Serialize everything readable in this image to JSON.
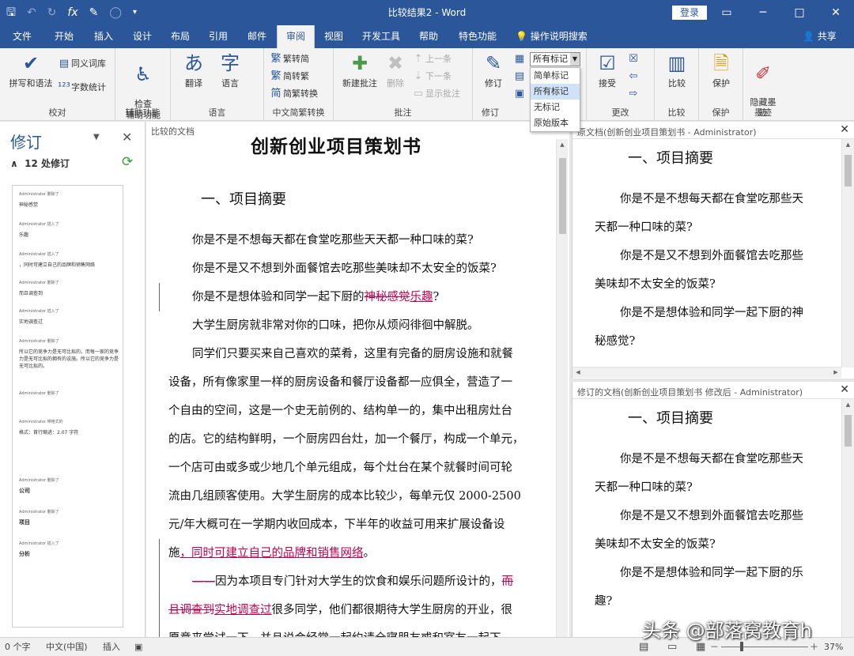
{
  "window": {
    "title": "比较结果2 - Word",
    "login": "登录",
    "controls": [
      "▭",
      "─",
      "□",
      "✕"
    ]
  },
  "qat": {
    "save": "🖫",
    "undo": "↶",
    "redo": "↻",
    "fx": "fx",
    "brush": "✎",
    "circle": "◯",
    "more": "▾"
  },
  "tabs": [
    {
      "label": "文件"
    },
    {
      "label": "开始"
    },
    {
      "label": "插入"
    },
    {
      "label": "设计"
    },
    {
      "label": "布局"
    },
    {
      "label": "引用"
    },
    {
      "label": "邮件"
    },
    {
      "label": "审阅"
    },
    {
      "label": "视图"
    },
    {
      "label": "开发工具"
    },
    {
      "label": "帮助"
    },
    {
      "label": "特色功能"
    }
  ],
  "tellme": "💡 操作说明搜索",
  "share": "👤 共享",
  "ribbon": {
    "groups": [
      "校对",
      "辅助功能",
      "语言",
      "中文简繁转换",
      "批注",
      "修订",
      "更改",
      "比较",
      "保护",
      "墨迹"
    ],
    "spelling": "拼写和语法",
    "thesaurus": "同义词库",
    "wordcount": "字数统计",
    "accessibility": "检查\n辅助功能",
    "translate": "翻译",
    "language": "语言",
    "trad": "繁转简",
    "simp": "简转繁",
    "convert": "简繁转换",
    "new_comment": "新建批注",
    "delete": "删除",
    "prev": "上一条",
    "next": "下一条",
    "show_comments": "显示批注",
    "track": "修订",
    "accept": "接受",
    "compare": "比较",
    "protect": "保护",
    "ink": "隐藏墨\n迹",
    "markup_selected": "所有标记",
    "markup_options": [
      "简单标记",
      "所有标记",
      "无标记",
      "原始版本"
    ]
  },
  "revisions": {
    "title": "修订",
    "count": "12 处修订",
    "items": [
      {
        "author": "Administrator 删除了",
        "text": "神秘感觉"
      },
      {
        "author": "Administrator 插入了",
        "text": "乐趣"
      },
      {
        "author": "Administrator 插入了",
        "text": "，同时可建立自己的品牌和销售网络"
      },
      {
        "author": "Administrator 删除了",
        "text": "而且调查到"
      },
      {
        "author": "Administrator 插入了",
        "text": "实地调查过"
      },
      {
        "author": "Administrator 删除了",
        "text": "所以它的竞争力是无可比拟的，而每一家的竞争力是无可比拟的拥有的设施。所以它的竞争力是无可比拟的。"
      },
      {
        "author": "Administrator 删除了",
        "text": ""
      },
      {
        "author": "Administrator 带格式的",
        "text": "格式：首行缩进：2.07 字符"
      },
      {
        "author": "Administrator 删除了",
        "text": "公司"
      },
      {
        "author": "Administrator 删除了",
        "text": "项目"
      },
      {
        "author": "Administrator 插入了",
        "text": "分析"
      }
    ]
  },
  "doc": {
    "label": "比较的文档",
    "title": "创新创业项目策划书",
    "heading": "一、项目摘要",
    "l1": "你是不是不想每天都在食堂吃那些天天都一种口味的菜?",
    "l2": "你是不是又不想到外面餐馆去吃那些美味却不太安全的饭菜?",
    "l3a": "你是不是想体验和同学一起下厨的",
    "l3del": "神秘感觉",
    "l3ins": "乐趣",
    "l3b": "?",
    "l4": "大学生厨房就非常对你的口味，把你从烦闷徘徊中解脱。",
    "l5": "同学们只要买来自己喜欢的菜肴，这里有完备的厨房设施和就餐",
    "l6": "设备，所有像家里一样的厨房设备和餐厅设备都一应俱全，营造了一",
    "l7": "个自由的空间，这是一个史无前例的、结构单一的，集中出租房灶台",
    "l8": "的店。它的结构鲜明，一个厨房四台灶，加一个餐厅，构成一个单元，",
    "l9": "一个店可由或多或少地几个单元组成，每个灶台在某个就餐时间可轮",
    "l10": "流由几组顾客使用。大学生厨房的成本比较少，每单元仅 2000-2500",
    "l11": "元/年大概可在一学期内收回成本，下半年的收益可用来扩展设备设",
    "l12a": "施",
    "l12ins": "，同时可建立自己的品牌和销售网络",
    "l12b": "。",
    "l13del1": "——",
    "l13a": "因为本项目专门针对大学生的饮食和娱乐问题所设计的，",
    "l13del2": "而",
    "l14del": "且调查到",
    "l14ins": "实地调查过",
    "l14b": "很多同学，他们都很期待大学生厨房的开业，很",
    "l15": "愿意来尝试一下，并且说会经常一起约请全寝朋友或和室友一起下"
  },
  "original": {
    "label": "原文档(创新创业项目策划书 - Administrator)",
    "heading": "一、项目摘要",
    "lines": [
      "你是不是不想每天都在食堂吃那些天",
      "天都一种口味的菜?",
      "你是不是又不想到外面餐馆去吃那些",
      "美味却不太安全的饭菜?",
      "你是不是想体验和同学一起下厨的神",
      "秘感觉?"
    ]
  },
  "revised": {
    "label": "修订的文档(创新创业项目策划书 修改后 - Administrator)",
    "heading": "一、项目摘要",
    "lines": [
      "你是不是不想每天都在食堂吃那些天",
      "天都一种口味的菜?",
      "你是不是又不想到外面餐馆去吃那些",
      "美味却不太安全的饭菜?",
      "你是不是想体验和同学一起下厨的乐",
      "趣?"
    ]
  },
  "status": {
    "words": "0 个字",
    "lang": "中文(中国)",
    "insert": "插入",
    "zoom": "37%",
    "minus": "－",
    "plus": "＋"
  },
  "watermark": "头条 @部落窝教育h",
  "colors": {
    "brand": "#2b579a",
    "revision": "#c4004e"
  }
}
